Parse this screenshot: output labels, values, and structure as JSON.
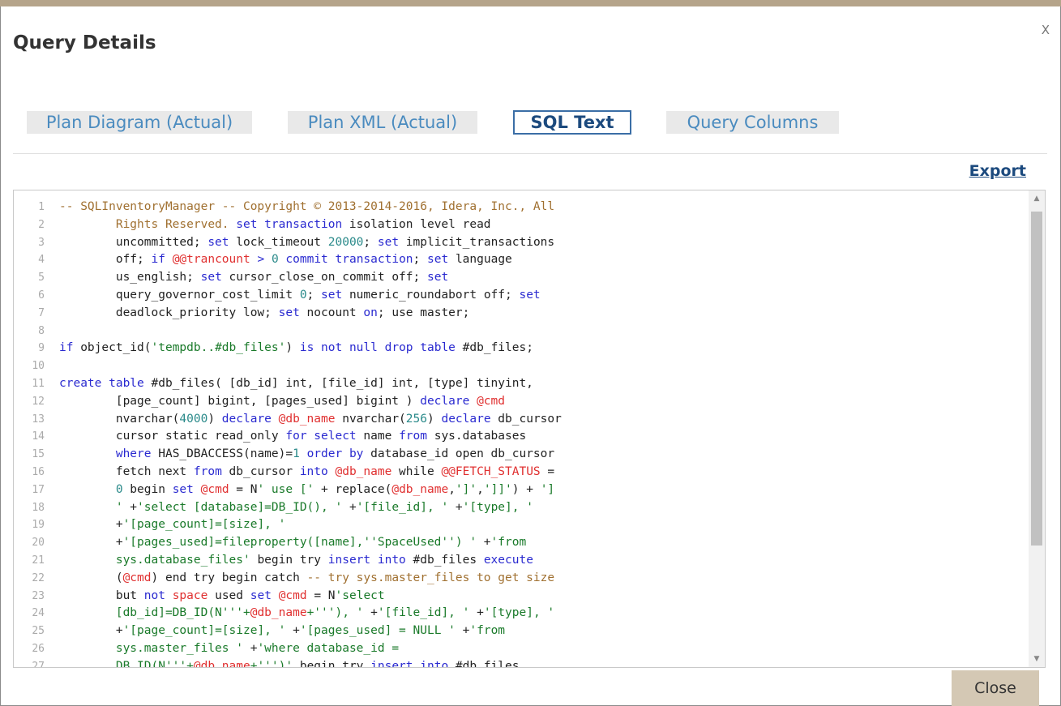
{
  "dialog": {
    "title": "Query Details",
    "close_x": "X",
    "export_label": "Export",
    "close_button": "Close"
  },
  "tabs": [
    {
      "label": "Plan Diagram (Actual)",
      "active": false
    },
    {
      "label": "Plan XML (Actual)",
      "active": false
    },
    {
      "label": "SQL Text",
      "active": true
    },
    {
      "label": "Query Columns",
      "active": false
    }
  ],
  "colors": {
    "header_bar": "#b5a48a",
    "tab_bg": "#e9e9e9",
    "tab_text": "#4a8bbf",
    "active_tab_border": "#3b6ea6",
    "close_button_bg": "#d4c8b4"
  },
  "editor": {
    "lines": [
      {
        "n": "1",
        "segs": [
          [
            "cm",
            "-- SQLInventoryManager -- Copyright © 2013-2014-2016, Idera, Inc., All"
          ]
        ]
      },
      {
        "n": "2",
        "segs": [
          [
            "",
            "        "
          ],
          [
            "cm",
            "Rights Reserved. "
          ],
          [
            "kw",
            "set transaction"
          ],
          [
            "",
            " isolation level read"
          ]
        ]
      },
      {
        "n": "3",
        "segs": [
          [
            "",
            "        uncommitted; "
          ],
          [
            "kw",
            "set"
          ],
          [
            "",
            " lock_timeout "
          ],
          [
            "num",
            "20000"
          ],
          [
            "",
            "; "
          ],
          [
            "kw",
            "set"
          ],
          [
            "",
            " implicit_transactions"
          ]
        ]
      },
      {
        "n": "4",
        "segs": [
          [
            "",
            "        off; "
          ],
          [
            "kw",
            "if"
          ],
          [
            "",
            " "
          ],
          [
            "var",
            "@@trancount"
          ],
          [
            "",
            " "
          ],
          [
            "kw",
            ">"
          ],
          [
            "",
            " "
          ],
          [
            "num",
            "0"
          ],
          [
            "",
            " "
          ],
          [
            "kw",
            "commit transaction"
          ],
          [
            "",
            "; "
          ],
          [
            "kw",
            "set"
          ],
          [
            "",
            " language"
          ]
        ]
      },
      {
        "n": "5",
        "segs": [
          [
            "",
            "        us_english; "
          ],
          [
            "kw",
            "set"
          ],
          [
            "",
            " cursor_close_on_commit off; "
          ],
          [
            "kw",
            "set"
          ]
        ]
      },
      {
        "n": "6",
        "segs": [
          [
            "",
            "        query_governor_cost_limit "
          ],
          [
            "num",
            "0"
          ],
          [
            "",
            "; "
          ],
          [
            "kw",
            "set"
          ],
          [
            "",
            " numeric_roundabort off; "
          ],
          [
            "kw",
            "set"
          ]
        ]
      },
      {
        "n": "7",
        "segs": [
          [
            "",
            "        deadlock_priority low; "
          ],
          [
            "kw",
            "set"
          ],
          [
            "",
            " nocount "
          ],
          [
            "kw",
            "on"
          ],
          [
            "",
            "; use master;"
          ]
        ]
      },
      {
        "n": "8",
        "segs": [
          [
            "",
            ""
          ]
        ]
      },
      {
        "n": "9",
        "segs": [
          [
            "kw",
            "if"
          ],
          [
            "",
            " object_id("
          ],
          [
            "str",
            "'tempdb..#db_files'"
          ],
          [
            "",
            ") "
          ],
          [
            "kw",
            "is not null"
          ],
          [
            "",
            " "
          ],
          [
            "kw",
            "drop table"
          ],
          [
            "",
            " #db_files;"
          ]
        ]
      },
      {
        "n": "10",
        "segs": [
          [
            "",
            ""
          ]
        ]
      },
      {
        "n": "11",
        "segs": [
          [
            "kw",
            "create table"
          ],
          [
            "",
            " #db_files( [db_id] int, [file_id] int, [type] tinyint,"
          ]
        ]
      },
      {
        "n": "12",
        "segs": [
          [
            "",
            "        [page_count] bigint, [pages_used] bigint ) "
          ],
          [
            "kw",
            "declare"
          ],
          [
            "",
            " "
          ],
          [
            "var",
            "@cmd"
          ]
        ]
      },
      {
        "n": "13",
        "segs": [
          [
            "",
            "        nvarchar("
          ],
          [
            "num",
            "4000"
          ],
          [
            "",
            ") "
          ],
          [
            "kw",
            "declare"
          ],
          [
            "",
            " "
          ],
          [
            "var",
            "@db_name"
          ],
          [
            "",
            " nvarchar("
          ],
          [
            "num",
            "256"
          ],
          [
            "",
            ") "
          ],
          [
            "kw",
            "declare"
          ],
          [
            "",
            " db_cursor"
          ]
        ]
      },
      {
        "n": "14",
        "segs": [
          [
            "",
            "        cursor static read_only "
          ],
          [
            "kw",
            "for select"
          ],
          [
            "",
            " name "
          ],
          [
            "kw",
            "from"
          ],
          [
            "",
            " sys.databases"
          ]
        ]
      },
      {
        "n": "15",
        "segs": [
          [
            "",
            "        "
          ],
          [
            "kw",
            "where"
          ],
          [
            "",
            " HAS_DBACCESS(name)="
          ],
          [
            "num",
            "1"
          ],
          [
            "",
            " "
          ],
          [
            "kw",
            "order by"
          ],
          [
            "",
            " database_id open db_cursor"
          ]
        ]
      },
      {
        "n": "16",
        "segs": [
          [
            "",
            "        fetch next "
          ],
          [
            "kw",
            "from"
          ],
          [
            "",
            " db_cursor "
          ],
          [
            "kw",
            "into"
          ],
          [
            "",
            " "
          ],
          [
            "var",
            "@db_name"
          ],
          [
            "",
            " while "
          ],
          [
            "var",
            "@@FETCH_STATUS"
          ],
          [
            "",
            " ="
          ]
        ]
      },
      {
        "n": "17",
        "segs": [
          [
            "",
            "        "
          ],
          [
            "num",
            "0"
          ],
          [
            "",
            " begin "
          ],
          [
            "kw",
            "set"
          ],
          [
            "",
            " "
          ],
          [
            "var",
            "@cmd"
          ],
          [
            "",
            " = N"
          ],
          [
            "str",
            "' use ['"
          ],
          [
            "",
            " + replace("
          ],
          [
            "var",
            "@db_name"
          ],
          [
            "",
            ","
          ],
          [
            "str",
            "']'"
          ],
          [
            "",
            ","
          ],
          [
            "str",
            "']]'"
          ],
          [
            "",
            ") + "
          ],
          [
            "str",
            "']"
          ]
        ]
      },
      {
        "n": "18",
        "segs": [
          [
            "",
            "        "
          ],
          [
            "str",
            "'"
          ],
          [
            "",
            " +"
          ],
          [
            "str",
            "'select [database]=DB_ID(), '"
          ],
          [
            "",
            " +"
          ],
          [
            "str",
            "'[file_id], '"
          ],
          [
            "",
            " +"
          ],
          [
            "str",
            "'[type], '"
          ]
        ]
      },
      {
        "n": "19",
        "segs": [
          [
            "",
            "        +"
          ],
          [
            "str",
            "'[page_count]=[size], '"
          ]
        ]
      },
      {
        "n": "20",
        "segs": [
          [
            "",
            "        +"
          ],
          [
            "str",
            "'[pages_used]=fileproperty([name],''SpaceUsed'') '"
          ],
          [
            "",
            " +"
          ],
          [
            "str",
            "'from"
          ]
        ]
      },
      {
        "n": "21",
        "segs": [
          [
            "",
            "        "
          ],
          [
            "str",
            "sys.database_files'"
          ],
          [
            "",
            " begin try "
          ],
          [
            "kw",
            "insert into"
          ],
          [
            "",
            " #db_files "
          ],
          [
            "kw",
            "execute"
          ]
        ]
      },
      {
        "n": "22",
        "segs": [
          [
            "",
            "        ("
          ],
          [
            "var",
            "@cmd"
          ],
          [
            "",
            ") end try begin catch "
          ],
          [
            "cm",
            "-- try sys.master_files to get size"
          ]
        ]
      },
      {
        "n": "23",
        "segs": [
          [
            "",
            "        but "
          ],
          [
            "kw",
            "not"
          ],
          [
            "",
            " "
          ],
          [
            "var",
            "space"
          ],
          [
            "",
            " used "
          ],
          [
            "kw",
            "set"
          ],
          [
            "",
            " "
          ],
          [
            "var",
            "@cmd"
          ],
          [
            "",
            " = N"
          ],
          [
            "str",
            "'select"
          ]
        ]
      },
      {
        "n": "24",
        "segs": [
          [
            "",
            "        "
          ],
          [
            "str",
            "[db_id]=DB_ID(N'''+"
          ],
          [
            "var",
            "@db_name"
          ],
          [
            "str",
            "+'''), '"
          ],
          [
            "",
            " +"
          ],
          [
            "str",
            "'[file_id], '"
          ],
          [
            "",
            " +"
          ],
          [
            "str",
            "'[type], '"
          ]
        ]
      },
      {
        "n": "25",
        "segs": [
          [
            "",
            "        +"
          ],
          [
            "str",
            "'[page_count]=[size], '"
          ],
          [
            "",
            " +"
          ],
          [
            "str",
            "'[pages_used] = NULL '"
          ],
          [
            "",
            " +"
          ],
          [
            "str",
            "'from"
          ]
        ]
      },
      {
        "n": "26",
        "segs": [
          [
            "",
            "        "
          ],
          [
            "str",
            "sys.master_files '"
          ],
          [
            "",
            " +"
          ],
          [
            "str",
            "'where database_id ="
          ]
        ]
      },
      {
        "n": "27",
        "segs": [
          [
            "",
            "        "
          ],
          [
            "str",
            "DB_ID(N'''+"
          ],
          [
            "var",
            "@db_name"
          ],
          [
            "str",
            "+''')'"
          ],
          [
            "",
            " begin try "
          ],
          [
            "kw",
            "insert into"
          ],
          [
            "",
            " #db_files"
          ]
        ]
      }
    ]
  }
}
